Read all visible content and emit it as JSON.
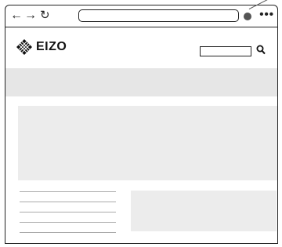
{
  "browser": {
    "back_icon": "arrow-left",
    "forward_icon": "arrow-right",
    "reload_icon": "reload",
    "menu_icon": "ellipsis",
    "address_value": ""
  },
  "site": {
    "logo_text": "EIZO",
    "search_value": ""
  },
  "colors": {
    "frame": "#222222",
    "placeholder_block": "#ececec",
    "nav_bar": "#e6e6e6",
    "cursor": "#555555"
  },
  "content": {
    "text_line_count": 5
  }
}
